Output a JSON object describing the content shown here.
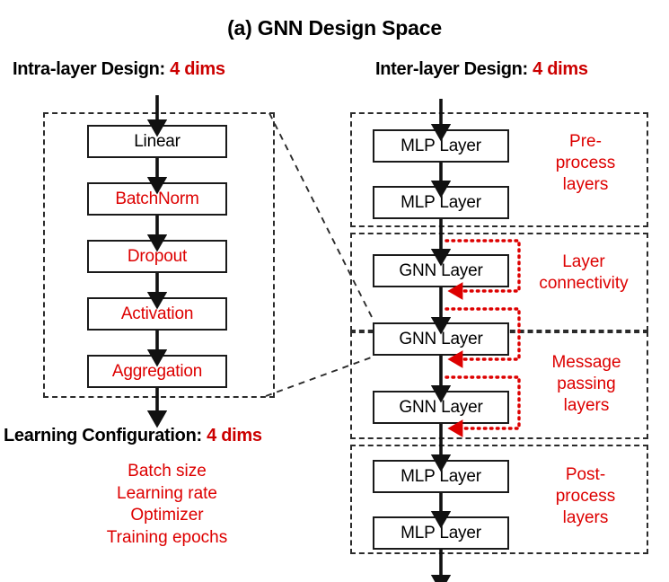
{
  "figure": {
    "title": "(a) GNN Design Space",
    "accent_red": "#dd0000",
    "ink_black": "#000000"
  },
  "headings": {
    "intra": {
      "label": "Intra-layer Design: ",
      "dims": "4 dims"
    },
    "inter": {
      "label": "Inter-layer Design: ",
      "dims": "4 dims"
    },
    "learning": {
      "label": "Learning Configuration: ",
      "dims": "4 dims"
    }
  },
  "intra_layer": {
    "boxes": [
      {
        "label": "Linear",
        "color": "black"
      },
      {
        "label": "BatchNorm",
        "color": "red"
      },
      {
        "label": "Dropout",
        "color": "red"
      },
      {
        "label": "Activation",
        "color": "red"
      },
      {
        "label": "Aggregation",
        "color": "red"
      }
    ]
  },
  "learning_configuration": {
    "items": [
      "Batch size",
      "Learning rate",
      "Optimizer",
      "Training epochs"
    ]
  },
  "inter_layer": {
    "stages": [
      {
        "name": "pre-process",
        "label_lines": [
          "Pre-",
          "process",
          "layers"
        ],
        "boxes": [
          {
            "label": "MLP Layer"
          },
          {
            "label": "MLP Layer"
          }
        ]
      },
      {
        "name": "layer-connectivity",
        "label_lines": [
          "Layer",
          "connectivity"
        ],
        "boxes": [
          {
            "label": "GNN Layer"
          }
        ]
      },
      {
        "name": "message-passing",
        "label_lines": [
          "Message",
          "passing",
          "layers"
        ],
        "boxes": [
          {
            "label": "GNN Layer"
          },
          {
            "label": "GNN Layer"
          }
        ]
      },
      {
        "name": "post-process",
        "label_lines": [
          "Post-",
          "process",
          "layers"
        ],
        "boxes": [
          {
            "label": "MLP Layer"
          },
          {
            "label": "MLP Layer"
          }
        ]
      }
    ],
    "skip_connection_count": 3
  }
}
